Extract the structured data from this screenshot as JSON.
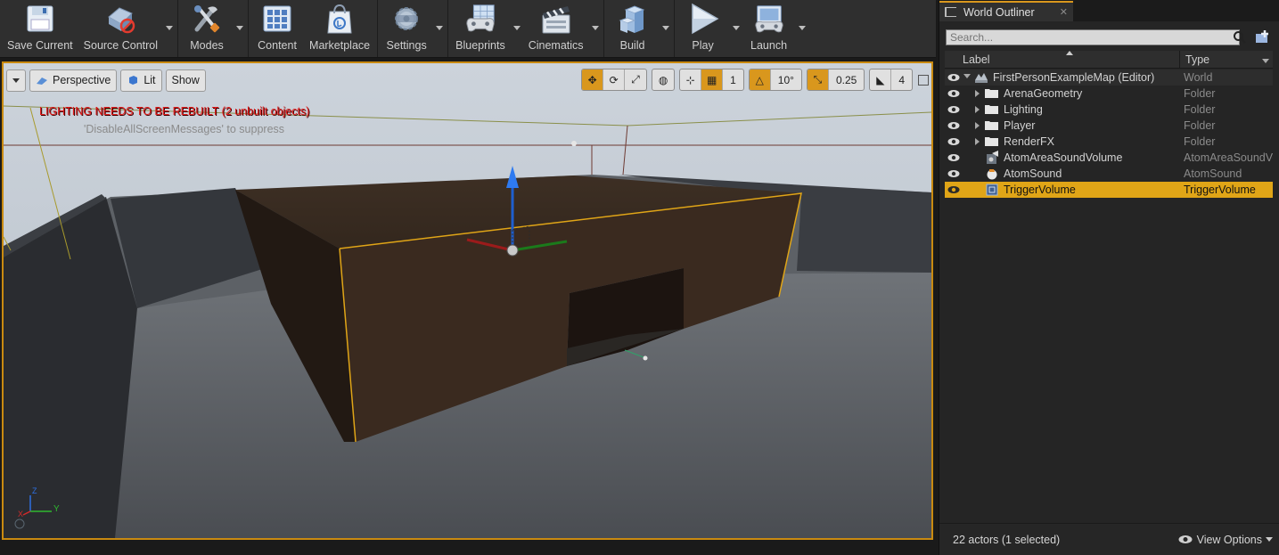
{
  "toolbar": {
    "buttons": [
      {
        "label": "Save Current",
        "icon": "save-icon"
      },
      {
        "label": "Source Control",
        "icon": "source-control-icon"
      },
      {
        "label": "Modes",
        "icon": "modes-icon"
      },
      {
        "label": "Content",
        "icon": "content-icon"
      },
      {
        "label": "Marketplace",
        "icon": "marketplace-icon"
      },
      {
        "label": "Settings",
        "icon": "settings-icon"
      },
      {
        "label": "Blueprints",
        "icon": "blueprints-icon"
      },
      {
        "label": "Cinematics",
        "icon": "cinematics-icon"
      },
      {
        "label": "Build",
        "icon": "build-icon"
      },
      {
        "label": "Play",
        "icon": "play-icon"
      },
      {
        "label": "Launch",
        "icon": "launch-icon"
      }
    ]
  },
  "viewport": {
    "perspective_label": "Perspective",
    "lit_label": "Lit",
    "show_label": "Show",
    "rotation_snap": "10°",
    "scale_snap": "0.25",
    "camera_speed": "4",
    "grid_snap": "1",
    "warning": "LIGHTING NEEDS TO BE REBUILT (2 unbuilt objects)",
    "suppress_hint": "'DisableAllScreenMessages' to suppress",
    "axis_labels": {
      "z": "Z",
      "x": "X",
      "y": "Y"
    },
    "colors": {
      "accent": "#d9971d",
      "warning": "#e21c1c",
      "selection": "#e0a517"
    }
  },
  "outliner": {
    "tab_title": "World Outliner",
    "search_placeholder": "Search...",
    "col_label": "Label",
    "col_type": "Type",
    "rows": [
      {
        "label": "FirstPersonExampleMap (Editor)",
        "type": "World"
      },
      {
        "label": "ArenaGeometry",
        "type": "Folder"
      },
      {
        "label": "Lighting",
        "type": "Folder"
      },
      {
        "label": "Player",
        "type": "Folder"
      },
      {
        "label": "RenderFX",
        "type": "Folder"
      },
      {
        "label": "AtomAreaSoundVolume",
        "type": "AtomAreaSoundVolume"
      },
      {
        "label": "AtomSound",
        "type": "AtomSound"
      },
      {
        "label": "TriggerVolume",
        "type": "TriggerVolume"
      }
    ],
    "status": "22 actors (1 selected)",
    "view_options": "View Options"
  }
}
